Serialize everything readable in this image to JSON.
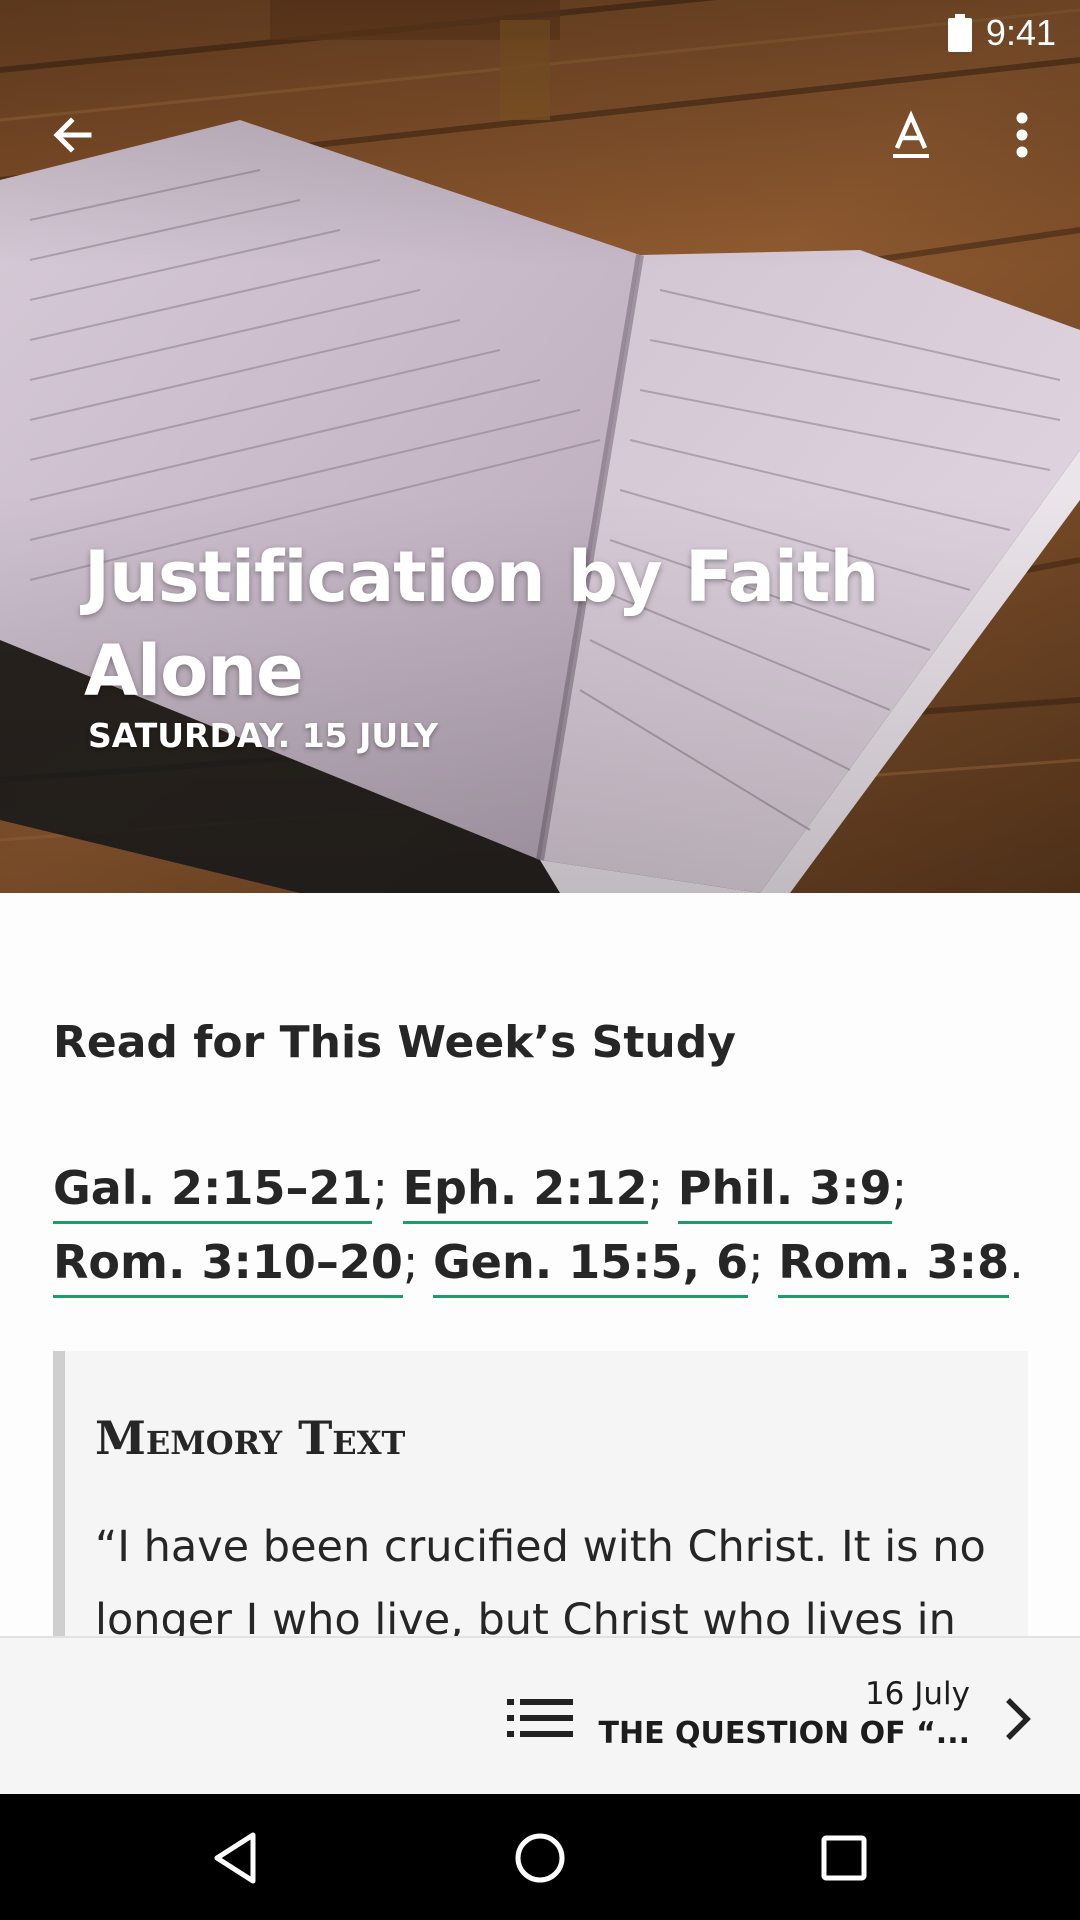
{
  "status_bar": {
    "time": "9:41",
    "battery_icon": "battery-full-icon"
  },
  "toolbar": {
    "back_icon": "arrow-left-icon",
    "font_icon": "text-format-icon",
    "more_icon": "more-vertical-icon"
  },
  "hero": {
    "title": "Justification by Faith Alone",
    "date": "SATURDAY. 15 JULY"
  },
  "content": {
    "section_title": "Read for This Week’s Study",
    "references": [
      {
        "text": "Gal. 2:15–21"
      },
      {
        "text": "Eph. 2:12"
      },
      {
        "text": "Phil. 3:9"
      },
      {
        "text": "Rom. 3:10–20"
      },
      {
        "text": "Gen. 15:5, 6"
      },
      {
        "text": "Rom. 3:8"
      }
    ],
    "memory": {
      "label": "Memory Text",
      "text": "“I have been crucified with Christ. It is no longer I who live, but Christ who lives in"
    }
  },
  "bottom_nav": {
    "list_icon": "list-icon",
    "next_date": "16 July",
    "next_title": "THE QUESTION OF “...",
    "next_icon": "chevron-right-icon"
  },
  "system_nav": {
    "back": "nav-back-icon",
    "home": "nav-home-icon",
    "recent": "nav-recent-icon"
  },
  "colors": {
    "link_underline": "#1f9a6a",
    "memory_border": "#cfcfcf",
    "bottom_bar": "#f5f5f5"
  }
}
